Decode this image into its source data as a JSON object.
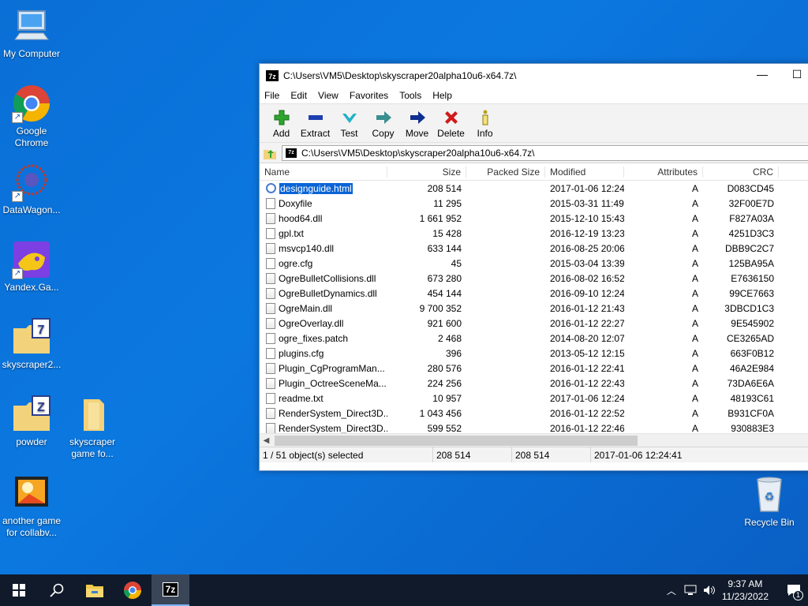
{
  "desktop": {
    "icons": [
      {
        "label": "My Computer"
      },
      {
        "label": "Google Chrome"
      },
      {
        "label": "DataWagon..."
      },
      {
        "label": "Yandex.Ga..."
      },
      {
        "label": "skyscraper2..."
      },
      {
        "label": "powder"
      },
      {
        "label": "skyscraper game fo..."
      },
      {
        "label": "another game for collabv..."
      },
      {
        "label": "Recycle Bin"
      }
    ]
  },
  "window": {
    "title": "C:\\Users\\VM5\\Desktop\\skyscraper20alpha10u6-x64.7z\\",
    "app_icon_text": "7z",
    "menu": [
      "File",
      "Edit",
      "View",
      "Favorites",
      "Tools",
      "Help"
    ],
    "toolbar": [
      {
        "label": "Add",
        "icon": "plus-icon",
        "color": "#2ea62e"
      },
      {
        "label": "Extract",
        "icon": "minus-icon",
        "color": "#1e3fb0"
      },
      {
        "label": "Test",
        "icon": "check-icon",
        "color": "#1fb3c9"
      },
      {
        "label": "Copy",
        "icon": "arrow-right-icon",
        "color": "#3a8f8f"
      },
      {
        "label": "Move",
        "icon": "arrow-right-icon",
        "color": "#0f2f8f"
      },
      {
        "label": "Delete",
        "icon": "x-icon",
        "color": "#d11a1a"
      },
      {
        "label": "Info",
        "icon": "info-icon",
        "color": "#b8a21c"
      }
    ],
    "address": "C:\\Users\\VM5\\Desktop\\skyscraper20alpha10u6-x64.7z\\",
    "columns": [
      "Name",
      "Size",
      "Packed Size",
      "Modified",
      "Attributes",
      "CRC"
    ],
    "files": [
      {
        "name": "designguide.html",
        "size": "208 514",
        "packed": "",
        "modified": "2017-01-06 12:24",
        "attr": "A",
        "crc": "D083CD45",
        "type": "html",
        "selected": true
      },
      {
        "name": "Doxyfile",
        "size": "11 295",
        "packed": "",
        "modified": "2015-03-31 11:49",
        "attr": "A",
        "crc": "32F00E7D",
        "type": "file"
      },
      {
        "name": "hood64.dll",
        "size": "1 661 952",
        "packed": "",
        "modified": "2015-12-10 15:43",
        "attr": "A",
        "crc": "F827A03A",
        "type": "dll"
      },
      {
        "name": "gpl.txt",
        "size": "15 428",
        "packed": "",
        "modified": "2016-12-19 13:23",
        "attr": "A",
        "crc": "4251D3C3",
        "type": "file"
      },
      {
        "name": "msvcp140.dll",
        "size": "633 144",
        "packed": "",
        "modified": "2016-08-25 20:06",
        "attr": "A",
        "crc": "DBB9C2C7",
        "type": "dll"
      },
      {
        "name": "ogre.cfg",
        "size": "45",
        "packed": "",
        "modified": "2015-03-04 13:39",
        "attr": "A",
        "crc": "125BA95A",
        "type": "file"
      },
      {
        "name": "OgreBulletCollisions.dll",
        "size": "673 280",
        "packed": "",
        "modified": "2016-08-02 16:52",
        "attr": "A",
        "crc": "E7636150",
        "type": "dll"
      },
      {
        "name": "OgreBulletDynamics.dll",
        "size": "454 144",
        "packed": "",
        "modified": "2016-09-10 12:24",
        "attr": "A",
        "crc": "99CE7663",
        "type": "dll"
      },
      {
        "name": "OgreMain.dll",
        "size": "9 700 352",
        "packed": "",
        "modified": "2016-01-12 21:43",
        "attr": "A",
        "crc": "3DBCD1C3",
        "type": "dll"
      },
      {
        "name": "OgreOverlay.dll",
        "size": "921 600",
        "packed": "",
        "modified": "2016-01-12 22:27",
        "attr": "A",
        "crc": "9E545902",
        "type": "dll"
      },
      {
        "name": "ogre_fixes.patch",
        "size": "2 468",
        "packed": "",
        "modified": "2014-08-20 12:07",
        "attr": "A",
        "crc": "CE3265AD",
        "type": "file"
      },
      {
        "name": "plugins.cfg",
        "size": "396",
        "packed": "",
        "modified": "2013-05-12 12:15",
        "attr": "A",
        "crc": "663F0B12",
        "type": "file"
      },
      {
        "name": "Plugin_CgProgramMan...",
        "size": "280 576",
        "packed": "",
        "modified": "2016-01-12 22:41",
        "attr": "A",
        "crc": "46A2E984",
        "type": "dll"
      },
      {
        "name": "Plugin_OctreeSceneMa...",
        "size": "224 256",
        "packed": "",
        "modified": "2016-01-12 22:43",
        "attr": "A",
        "crc": "73DA6E6A",
        "type": "dll"
      },
      {
        "name": "readme.txt",
        "size": "10 957",
        "packed": "",
        "modified": "2017-01-06 12:24",
        "attr": "A",
        "crc": "48193C61",
        "type": "file"
      },
      {
        "name": "RenderSystem_Direct3D...",
        "size": "1 043 456",
        "packed": "",
        "modified": "2016-01-12 22:52",
        "attr": "A",
        "crc": "B931CF0A",
        "type": "dll"
      },
      {
        "name": "RenderSystem_Direct3D...",
        "size": "599 552",
        "packed": "",
        "modified": "2016-01-12 22:46",
        "attr": "A",
        "crc": "930883E3",
        "type": "dll"
      }
    ],
    "status": {
      "selection": "1 / 51 object(s) selected",
      "size": "208 514",
      "packed": "208 514",
      "modified": "2017-01-06 12:24:41"
    }
  },
  "taskbar": {
    "time": "9:37 AM",
    "date": "11/23/2022",
    "notification_count": "1",
    "app_7z_label": "7z"
  }
}
